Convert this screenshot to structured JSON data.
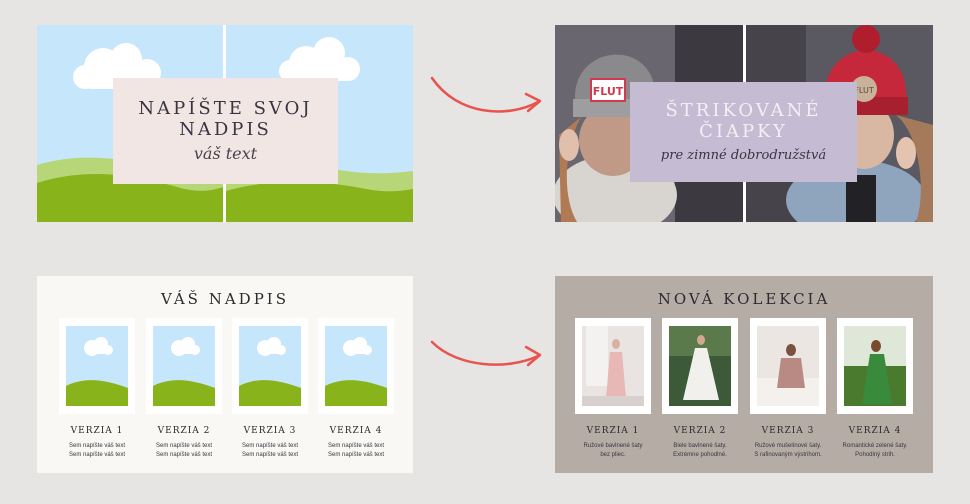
{
  "top_template": {
    "title": "NAPÍŠTE SVOJ\nNADPIS",
    "subtitle": "váš text"
  },
  "top_finished": {
    "title": "ŠTRIKOVANÉ\nČIAPKY",
    "subtitle": "pre zimné dobrodružstvá",
    "hat_tag_left": "FLUT",
    "hat_tag_right": "FLUT"
  },
  "bottom_template": {
    "title": "VÁŠ NADPIS",
    "cards": [
      {
        "label": "VERZIA 1",
        "text": "Sem napíšte váš text\nSem napíšte váš text"
      },
      {
        "label": "VERZIA 2",
        "text": "Sem napíšte váš text\nSem napíšte váš text"
      },
      {
        "label": "VERZIA 3",
        "text": "Sem napíšte váš text\nSem napíšte váš text"
      },
      {
        "label": "VERZIA 4",
        "text": "Sem napíšte váš text\nSem napíšte váš text"
      }
    ]
  },
  "bottom_finished": {
    "title": "NOVÁ KOLEKCIA",
    "cards": [
      {
        "label": "VERZIA 1",
        "text": "Ružové bavlnené šaty\nbez pliec."
      },
      {
        "label": "VERZIA 2",
        "text": "Biele bavlnené šaty.\nExtrémne pohodlné."
      },
      {
        "label": "VERZIA 3",
        "text": "Ružové mušelínové šaty.\nS rafinovaným výstrihom."
      },
      {
        "label": "VERZIA 4",
        "text": "Romantické zelené šaty.\nPohodlný strih."
      }
    ]
  },
  "colors": {
    "background": "#e6e5e3",
    "arrow": "#e8534e",
    "sky": "#c6e6fb",
    "grass": "#88b31a",
    "card_pink": "#f1e6e4",
    "card_lavender": "#c5bcd3",
    "panel_taupe": "#b6aca6"
  },
  "icons": [
    "cloud-icon",
    "arrow-icon"
  ]
}
